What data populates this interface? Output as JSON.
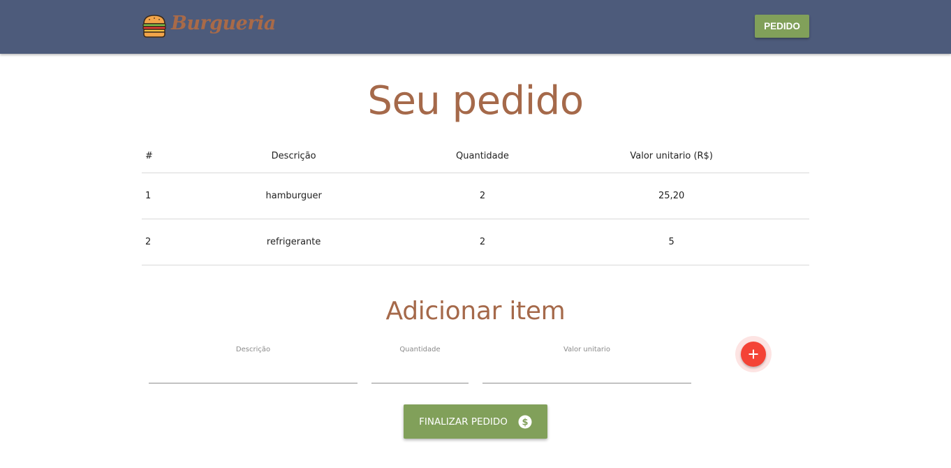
{
  "navbar": {
    "brand_name": "Burgueria",
    "pedido_button": "PEDIDO"
  },
  "main": {
    "title": "Seu pedido",
    "table": {
      "headers": [
        "#",
        "Descrição",
        "Quantidade",
        "Valor unitario (R$)"
      ],
      "rows": [
        [
          "1",
          "hamburguer",
          "2",
          "25,20"
        ],
        [
          "2",
          "refrigerante",
          "2",
          "5"
        ]
      ]
    }
  },
  "add_item": {
    "title": "Adicionar item",
    "fields": {
      "descricao": {
        "label": "Descrição",
        "value": ""
      },
      "quantidade": {
        "label": "Quantidade",
        "value": ""
      },
      "valor": {
        "label": "Valor unitario",
        "value": ""
      }
    },
    "add_icon": "plus-icon"
  },
  "finalize": {
    "label": "FINALIZAR PEDIDO",
    "icon": "dollar-circle-icon"
  },
  "colors": {
    "navbar": "#4d5b7b",
    "brand": "#a96a48",
    "accent_green": "#81a05a",
    "title_brown": "#a5694a",
    "fab_red": "#f44336"
  }
}
